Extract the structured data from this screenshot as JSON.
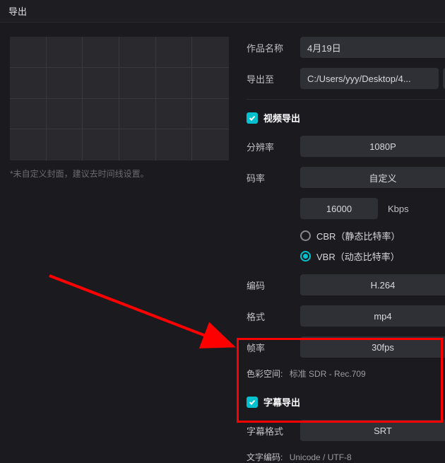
{
  "titlebar": {
    "title": "导出"
  },
  "preview": {
    "note": "*未自定义封面，建议去时间线设置。"
  },
  "form": {
    "name_label": "作品名称",
    "name_value": "4月19日",
    "path_label": "导出至",
    "path_value": "C:/Users/yyy/Desktop/4..."
  },
  "video": {
    "section_title": "视频导出",
    "resolution_label": "分辨率",
    "resolution_value": "1080P",
    "bitrate_label": "码率",
    "bitrate_value": "自定义",
    "bitrate_num": "16000",
    "bitrate_unit": "Kbps",
    "cbr_label": "CBR（静态比特率）",
    "vbr_label": "VBR（动态比特率）",
    "encoding_label": "编码",
    "encoding_value": "H.264",
    "format_label": "格式",
    "format_value": "mp4",
    "fps_label": "帧率",
    "fps_value": "30fps",
    "colorspace_label": "色彩空间:",
    "colorspace_value": "标准 SDR - Rec.709"
  },
  "subtitle": {
    "section_title": "字幕导出",
    "format_label": "字幕格式",
    "format_value": "SRT",
    "encoding_label": "文字编码:",
    "encoding_value": "Unicode / UTF-8"
  }
}
